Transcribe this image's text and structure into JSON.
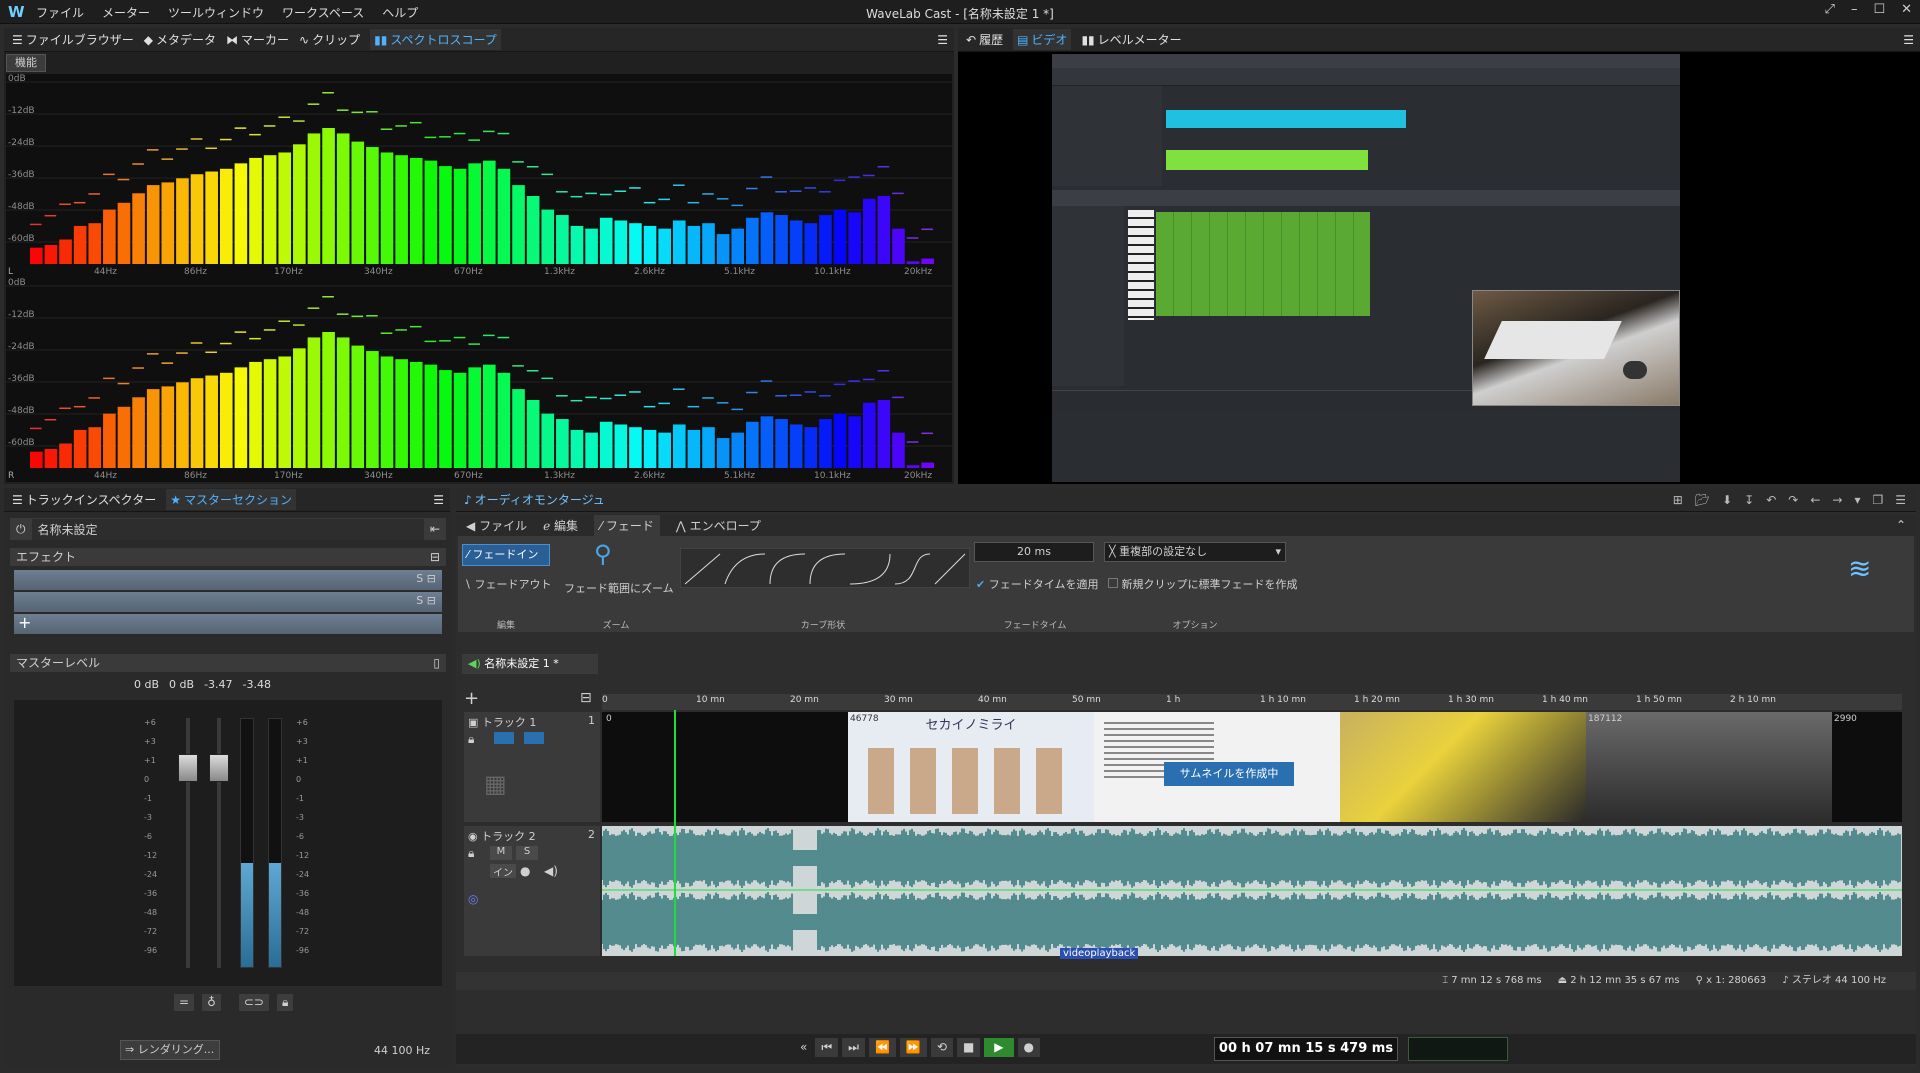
{
  "app": {
    "title": "WaveLab Cast - [名称未設定 1 *]",
    "menus": [
      "ファイル",
      "メーター",
      "ツールウィンドウ",
      "ワークスペース",
      "ヘルプ"
    ]
  },
  "top_left_tabs": [
    {
      "label": "ファイルブラウザー",
      "icon": "menu-icon"
    },
    {
      "label": "メタデータ",
      "icon": "tag-icon"
    },
    {
      "label": "マーカー",
      "icon": "marker-icon"
    },
    {
      "label": "クリップ",
      "icon": "clip-icon"
    },
    {
      "label": "スペクトロスコープ",
      "icon": "bar-chart-icon",
      "active": true
    }
  ],
  "function_label": "機能",
  "spectroscope": {
    "db_labels": [
      "0dB",
      "-12dB",
      "-24dB",
      "-36dB",
      "-48dB",
      "-60dB"
    ],
    "freq_labels": [
      "44Hz",
      "86Hz",
      "170Hz",
      "340Hz",
      "670Hz",
      "1.3kHz",
      "2.6kHz",
      "5.1kHz",
      "10.1kHz",
      "20kHz"
    ],
    "channels": [
      "L",
      "R"
    ],
    "bars_l": [
      12,
      14,
      18,
      28,
      30,
      40,
      45,
      52,
      58,
      60,
      63,
      66,
      68,
      70,
      74,
      78,
      80,
      82,
      88,
      96,
      100,
      96,
      90,
      86,
      82,
      80,
      78,
      76,
      72,
      70,
      74,
      76,
      70,
      58,
      50,
      40,
      36,
      28,
      26,
      34,
      32,
      30,
      28,
      26,
      32,
      28,
      30,
      22,
      26,
      34,
      38,
      36,
      32,
      30,
      36,
      40,
      38,
      48,
      50,
      26,
      2,
      4
    ],
    "bars_r": [
      12,
      14,
      18,
      28,
      30,
      40,
      45,
      52,
      58,
      60,
      63,
      66,
      68,
      70,
      74,
      78,
      80,
      82,
      88,
      96,
      100,
      96,
      90,
      86,
      82,
      80,
      78,
      76,
      72,
      70,
      74,
      76,
      70,
      58,
      50,
      40,
      36,
      28,
      26,
      34,
      32,
      30,
      28,
      26,
      32,
      28,
      30,
      22,
      26,
      34,
      38,
      36,
      32,
      30,
      36,
      40,
      38,
      48,
      50,
      26,
      2,
      4
    ]
  },
  "top_right_tabs": [
    {
      "label": "履歴",
      "icon": "undo-icon"
    },
    {
      "label": "ビデオ",
      "icon": "video-icon",
      "active": true
    },
    {
      "label": "レベルメーター",
      "icon": "level-icon"
    }
  ],
  "left_tabs": [
    {
      "label": "トラックインスペクター",
      "icon": "menu-icon"
    },
    {
      "label": "マスターセクション",
      "icon": "star-icon",
      "active": true
    }
  ],
  "master": {
    "preset_name": "名称未設定",
    "effects_label": "エフェクト",
    "master_level_label": "マスターレベル",
    "peak_values": [
      "0 dB",
      "0 dB",
      "-3.47",
      "-3.48"
    ],
    "scale": [
      "+6",
      "+3",
      "+1",
      "0",
      "-1",
      "-3",
      "-6",
      "-12",
      "-24",
      "-36",
      "-48",
      "-72",
      "-96"
    ],
    "render_label": "レンダリング...",
    "sample_rate": "44 100 Hz",
    "level_fraction_l": 0.42,
    "level_fraction_r": 0.42
  },
  "montage": {
    "title": "オーディオモンタージュ",
    "ribbon_tabs": [
      "ファイル",
      "編集",
      "フェード",
      "エンベロープ"
    ],
    "active_tab": "フェード",
    "fade_in": "フェードイン",
    "fade_out": "フェードアウト",
    "zoom_fade": "フェード範囲にズーム",
    "fade_time": "20 ms",
    "apply_fade_time": "フェードタイムを適用",
    "overlap": "重複部の設定なし",
    "new_clip_fade": "新規クリップに標準フェードを作成",
    "group_labels": [
      "編集",
      "ズーム",
      "カーブ形状",
      "フェードタイム",
      "オプション"
    ],
    "doc_tab": "名称未設定 1 *",
    "ruler": [
      "0",
      "10 mn",
      "20 mn",
      "30 mn",
      "40 mn",
      "50 mn",
      "1 h",
      "1 h 10 mn",
      "1 h 20 mn",
      "1 h 30 mn",
      "1 h 40 mn",
      "1 h 50 mn",
      "2 h 10 mn"
    ],
    "track1": "トラック 1",
    "track1_num": "1",
    "track2": "トラック 2",
    "track2_num": "2",
    "track1_markers": [
      "0",
      "46778",
      "187112",
      "2990"
    ],
    "thumb_title": "セカイノミライ",
    "thumb_overlay": "サムネイルを作成中",
    "clip_name": "videoplayback",
    "mute": "M",
    "solo": "S",
    "in_label": "イン",
    "status": {
      "cursor": "7 mn 12 s 768 ms",
      "length": "2 h 12 mn 35 s 67 ms",
      "zoom": "x 1: 280663",
      "format": "ステレオ 44 100 Hz"
    },
    "timecode": "00 h 07 mn 15 s 479 ms"
  }
}
